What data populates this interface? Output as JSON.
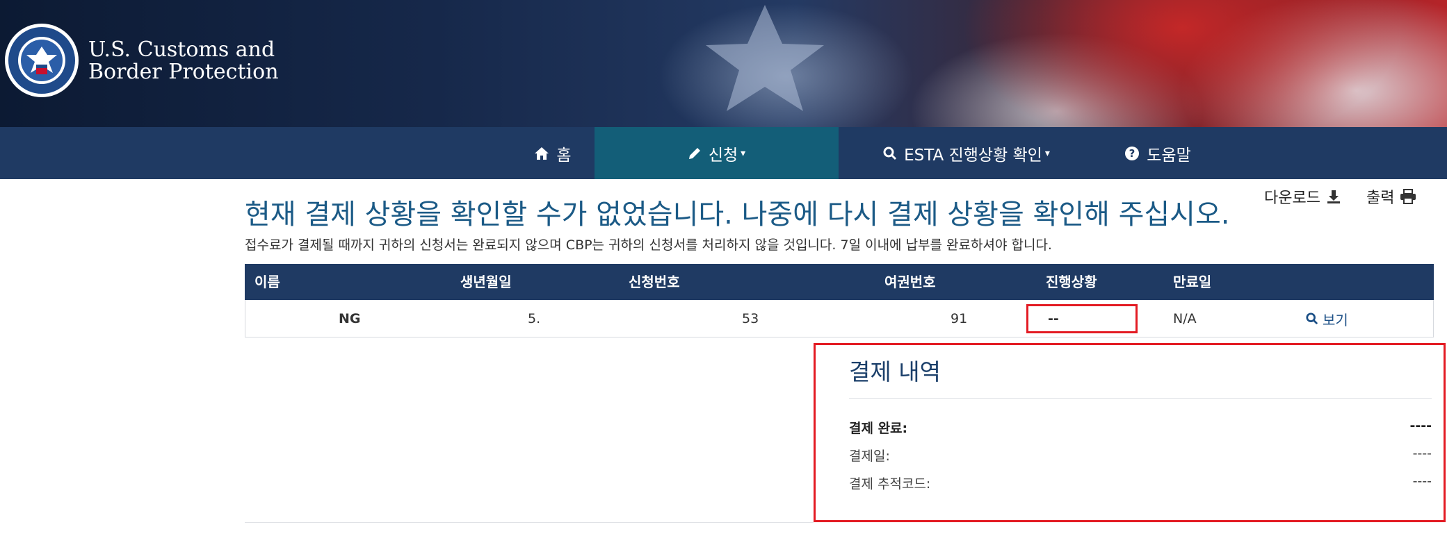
{
  "header": {
    "logo_line1": "U.S. Customs and",
    "logo_line2": "Border Protection"
  },
  "nav": {
    "home": "홈",
    "apply": "신청",
    "status": "ESTA 진행상황 확인",
    "help": "도움말"
  },
  "tools": {
    "download": "다운로드",
    "print": "출력"
  },
  "page": {
    "title": "현재 결제 상황을 확인할 수가 없었습니다. 나중에 다시 결제 상황을 확인해 주십시오.",
    "subtitle": "접수료가 결제될 때까지 귀하의 신청서는 완료되지 않으며 CBP는 귀하의 신청서를 처리하지 않을 것입니다. 7일 이내에 납부를 완료하셔야 합니다."
  },
  "table": {
    "headers": {
      "name": "이름",
      "dob": "생년월일",
      "app_no": "신청번호",
      "passport": "여권번호",
      "status": "진행상황",
      "expiry": "만료일"
    },
    "row": {
      "name": "NG",
      "dob": "5.",
      "app_no": "53",
      "passport": "91",
      "status": "--",
      "expiry": "N/A",
      "view": "보기"
    }
  },
  "payment": {
    "title": "결제 내역",
    "complete_label": "결제 완료:",
    "complete_value": "----",
    "date_label": "결제일:",
    "date_value": "----",
    "tracking_label": "결제 추적코드:",
    "tracking_value": "----"
  },
  "colors": {
    "navbar": "#1f3a63",
    "nav_active": "#135e78",
    "title_blue": "#1b5a86",
    "highlight_red": "#e31b23"
  }
}
